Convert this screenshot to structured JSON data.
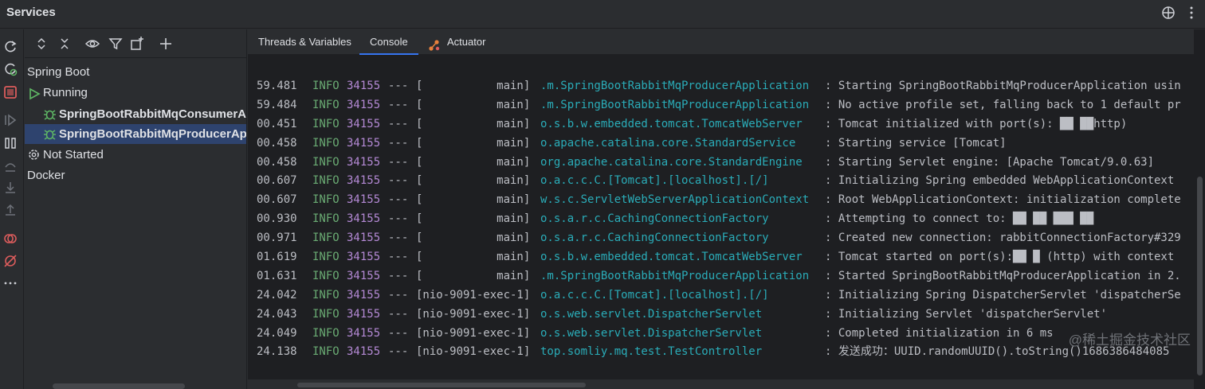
{
  "window": {
    "title": "Services"
  },
  "tree": {
    "root_label": "Spring Boot",
    "group_running": "Running",
    "app_consumer": "SpringBootRabbitMqConsumerApplication",
    "app_producer": "SpringBootRabbitMqProducerApplication",
    "group_not_started": "Not Started",
    "docker": "Docker"
  },
  "tabs": {
    "threads": "Threads & Variables",
    "console": "Console",
    "actuator": "Actuator"
  },
  "console": {
    "lines": [
      {
        "time": "59.481",
        "level": "INFO",
        "pid": "34155",
        "sep": "---",
        "thread": "[           main]",
        "logger": ".m.SpringBootRabbitMqProducerApplication",
        "message": ": Starting SpringBootRabbitMqProducerApplication usin"
      },
      {
        "time": "59.484",
        "level": "INFO",
        "pid": "34155",
        "sep": "---",
        "thread": "[           main]",
        "logger": ".m.SpringBootRabbitMqProducerApplication",
        "message": ": No active profile set, falling back to 1 default pr"
      },
      {
        "time": "00.451",
        "level": "INFO",
        "pid": "34155",
        "sep": "---",
        "thread": "[           main]",
        "logger": "o.s.b.w.embedded.tomcat.TomcatWebServer",
        "message": ": Tomcat initialized with port(s): ██ ██http)"
      },
      {
        "time": "00.458",
        "level": "INFO",
        "pid": "34155",
        "sep": "---",
        "thread": "[           main]",
        "logger": "o.apache.catalina.core.StandardService",
        "message": ": Starting service [Tomcat]"
      },
      {
        "time": "00.458",
        "level": "INFO",
        "pid": "34155",
        "sep": "---",
        "thread": "[           main]",
        "logger": "org.apache.catalina.core.StandardEngine",
        "message": ": Starting Servlet engine: [Apache Tomcat/9.0.63]"
      },
      {
        "time": "00.607",
        "level": "INFO",
        "pid": "34155",
        "sep": "---",
        "thread": "[           main]",
        "logger": "o.a.c.c.C.[Tomcat].[localhost].[/]",
        "message": ": Initializing Spring embedded WebApplicationContext"
      },
      {
        "time": "00.607",
        "level": "INFO",
        "pid": "34155",
        "sep": "---",
        "thread": "[           main]",
        "logger": "w.s.c.ServletWebServerApplicationContext",
        "message": ": Root WebApplicationContext: initialization complete"
      },
      {
        "time": "00.930",
        "level": "INFO",
        "pid": "34155",
        "sep": "---",
        "thread": "[           main]",
        "logger": "o.s.a.r.c.CachingConnectionFactory",
        "message": ": Attempting to connect to: ██ ██ ███ ██"
      },
      {
        "time": "00.971",
        "level": "INFO",
        "pid": "34155",
        "sep": "---",
        "thread": "[           main]",
        "logger": "o.s.a.r.c.CachingConnectionFactory",
        "message": ": Created new connection: rabbitConnectionFactory#329"
      },
      {
        "time": "01.619",
        "level": "INFO",
        "pid": "34155",
        "sep": "---",
        "thread": "[           main]",
        "logger": "o.s.b.w.embedded.tomcat.TomcatWebServer",
        "message": ": Tomcat started on port(s):██ █ (http) with context"
      },
      {
        "time": "01.631",
        "level": "INFO",
        "pid": "34155",
        "sep": "---",
        "thread": "[           main]",
        "logger": ".m.SpringBootRabbitMqProducerApplication",
        "message": ": Started SpringBootRabbitMqProducerApplication in 2."
      },
      {
        "time": "24.042",
        "level": "INFO",
        "pid": "34155",
        "sep": "---",
        "thread": "[nio-9091-exec-1]",
        "logger": "o.a.c.c.C.[Tomcat].[localhost].[/]",
        "message": ": Initializing Spring DispatcherServlet 'dispatcherSe"
      },
      {
        "time": "24.043",
        "level": "INFO",
        "pid": "34155",
        "sep": "---",
        "thread": "[nio-9091-exec-1]",
        "logger": "o.s.web.servlet.DispatcherServlet",
        "message": ": Initializing Servlet 'dispatcherServlet'"
      },
      {
        "time": "24.049",
        "level": "INFO",
        "pid": "34155",
        "sep": "---",
        "thread": "[nio-9091-exec-1]",
        "logger": "o.s.web.servlet.DispatcherServlet",
        "message": ": Completed initialization in 6 ms"
      },
      {
        "time": "24.138",
        "level": "INFO",
        "pid": "34155",
        "sep": "---",
        "thread": "[nio-9091-exec-1]",
        "logger": "top.somliy.mq.test.TestController",
        "message": ": 发送成功：UUID.randomUUID().toString()1686386484085"
      }
    ]
  },
  "watermark": "@稀土掘金技术社区",
  "colors": {
    "panel_bg": "#2b2d30",
    "console_bg": "#1e1f22",
    "selection": "#2e436e",
    "level_info": "#6aab73",
    "pid": "#b58ad6",
    "logger": "#2aacb8",
    "accent": "#3574f0",
    "stop_red": "#db5c5c",
    "run_green": "#5fb865",
    "actuator_orange": "#e8813c"
  },
  "icons": {
    "title_actions": [
      "crosshair-icon",
      "more-vertical-icon"
    ],
    "left_strip": [
      "rerun-icon",
      "rerun-debug-icon",
      "stop-icon",
      "resume-icon",
      "pause-icon",
      "step-over-icon",
      "step-into-icon",
      "step-out-icon",
      "breakpoint-icon",
      "mute-breakpoints-icon",
      "more-horizontal-icon"
    ],
    "tree_toolbar": [
      "expand-all-icon",
      "collapse-all-icon",
      "eye-icon",
      "filter-icon",
      "new-group-icon",
      "add-icon"
    ]
  }
}
